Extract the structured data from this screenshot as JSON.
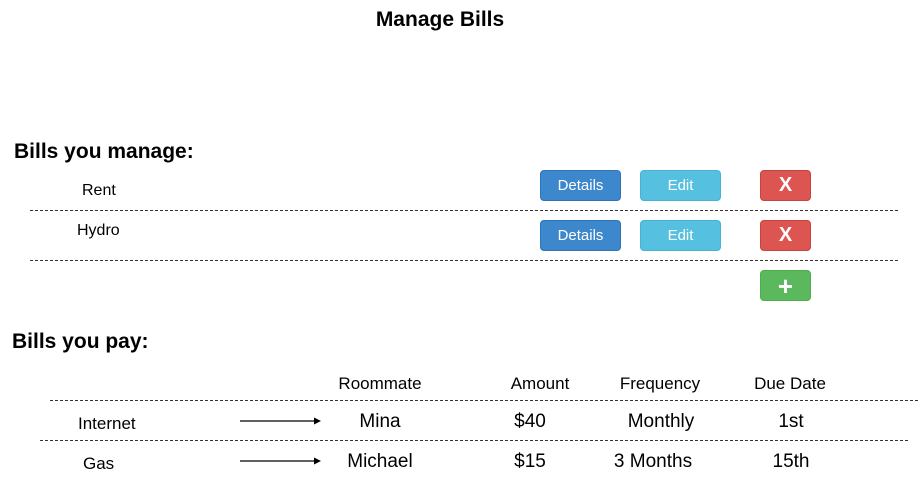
{
  "page_title": "Manage Bills",
  "managed": {
    "heading": "Bills you manage:",
    "bills": [
      {
        "name": "Rent"
      },
      {
        "name": "Hydro"
      }
    ],
    "details_label": "Details",
    "edit_label": "Edit",
    "delete_label": "X",
    "add_label": "+"
  },
  "paid": {
    "heading": "Bills you pay:",
    "columns": [
      "Roommate",
      "Amount",
      "Frequency",
      "Due Date"
    ],
    "rows": [
      {
        "bill": "Internet",
        "roommate": "Mina",
        "amount": "$40",
        "frequency": "Monthly",
        "due": "1st"
      },
      {
        "bill": "Gas",
        "roommate": "Michael",
        "amount": "$15",
        "frequency": "3 Months",
        "due": "15th"
      }
    ]
  },
  "colors": {
    "details": "#3d87cd",
    "edit": "#56c0e0",
    "delete": "#dc5550",
    "add": "#5cb85c"
  }
}
